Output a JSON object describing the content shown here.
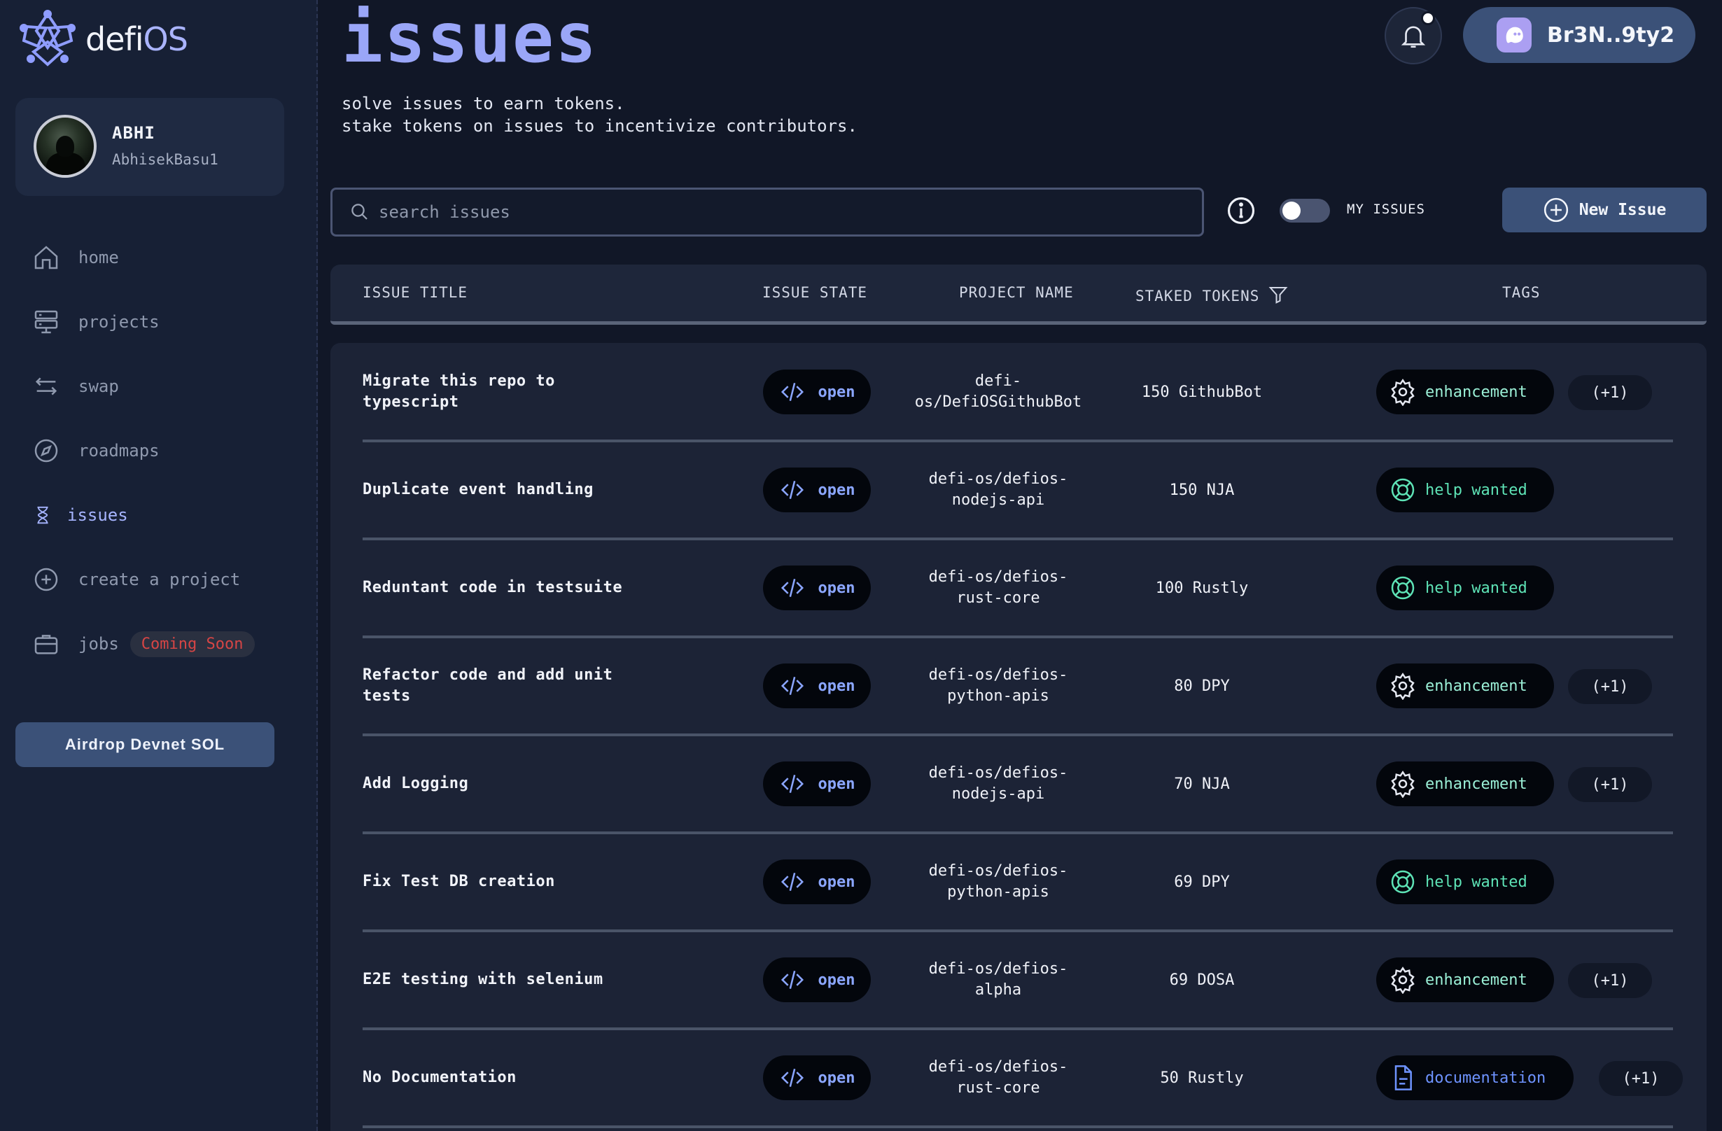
{
  "brand": {
    "name_prefix": "defi",
    "name_suffix": "OS"
  },
  "profile": {
    "name": "ABHI",
    "handle": "AbhisekBasu1"
  },
  "nav": [
    {
      "label": "home",
      "icon": "home-icon"
    },
    {
      "label": "projects",
      "icon": "server-icon"
    },
    {
      "label": "swap",
      "icon": "swap-arrows-icon"
    },
    {
      "label": "roadmaps",
      "icon": "compass-icon"
    },
    {
      "label": "issues",
      "icon": "hourglass-icon",
      "active": true
    },
    {
      "label": "create a project",
      "icon": "plus-circle-icon"
    },
    {
      "label": "jobs",
      "icon": "briefcase-icon",
      "badge": "Coming Soon"
    }
  ],
  "airdrop_label": "Airdrop Devnet SOL",
  "header": {
    "title": "issues",
    "subtitle_line1": "solve issues to earn tokens.",
    "subtitle_line2": "stake tokens on issues to incentivize contributors.",
    "wallet": "Br3N..9ty2"
  },
  "toolbar": {
    "search_placeholder": "search issues",
    "my_issues_label": "MY ISSUES",
    "my_issues_on": false,
    "new_issue_label": "New Issue"
  },
  "table": {
    "columns": [
      "ISSUE TITLE",
      "ISSUE STATE",
      "PROJECT NAME",
      "STAKED TOKENS",
      "TAGS"
    ],
    "rows": [
      {
        "title_l1": "Migrate this repo to",
        "title_l2": "typescript",
        "state": "open",
        "project_l1": "defi-",
        "project_l2": "os/DefiOSGithubBot",
        "stake": "150 GithubBot",
        "tag": "enhancement",
        "tag_type": "enh",
        "extra": "(+1)"
      },
      {
        "title_l1": "Duplicate event handling",
        "title_l2": "",
        "state": "open",
        "project_l1": "defi-os/defios-",
        "project_l2": "nodejs-api",
        "stake": "150 NJA",
        "tag": "help wanted",
        "tag_type": "help",
        "extra": ""
      },
      {
        "title_l1": "Reduntant code in testsuite",
        "title_l2": "",
        "state": "open",
        "project_l1": "defi-os/defios-",
        "project_l2": "rust-core",
        "stake": "100 Rustly",
        "tag": "help wanted",
        "tag_type": "help",
        "extra": ""
      },
      {
        "title_l1": "Refactor code and add unit",
        "title_l2": "tests",
        "state": "open",
        "project_l1": "defi-os/defios-",
        "project_l2": "python-apis",
        "stake": "80 DPY",
        "tag": "enhancement",
        "tag_type": "enh",
        "extra": "(+1)"
      },
      {
        "title_l1": "Add Logging",
        "title_l2": "",
        "state": "open",
        "project_l1": "defi-os/defios-",
        "project_l2": "nodejs-api",
        "stake": "70 NJA",
        "tag": "enhancement",
        "tag_type": "enh",
        "extra": "(+1)"
      },
      {
        "title_l1": "Fix Test DB creation",
        "title_l2": "",
        "state": "open",
        "project_l1": "defi-os/defios-",
        "project_l2": "python-apis",
        "stake": "69 DPY",
        "tag": "help wanted",
        "tag_type": "help",
        "extra": ""
      },
      {
        "title_l1": "E2E testing with selenium",
        "title_l2": "",
        "state": "open",
        "project_l1": "defi-os/defios-",
        "project_l2": "alpha",
        "stake": "69 DOSA",
        "tag": "enhancement",
        "tag_type": "enh",
        "extra": "(+1)"
      },
      {
        "title_l1": "No Documentation",
        "title_l2": "",
        "state": "open",
        "project_l1": "defi-os/defios-",
        "project_l2": "rust-core",
        "stake": "50 Rustly",
        "tag": "documentation",
        "tag_type": "doc",
        "extra": "(+1)"
      }
    ]
  },
  "colors": {
    "accent": "#9aa6f8",
    "button": "#3b5178",
    "help": "#5ee3b6",
    "doc": "#6e93ff",
    "badge_red": "#d64545"
  }
}
